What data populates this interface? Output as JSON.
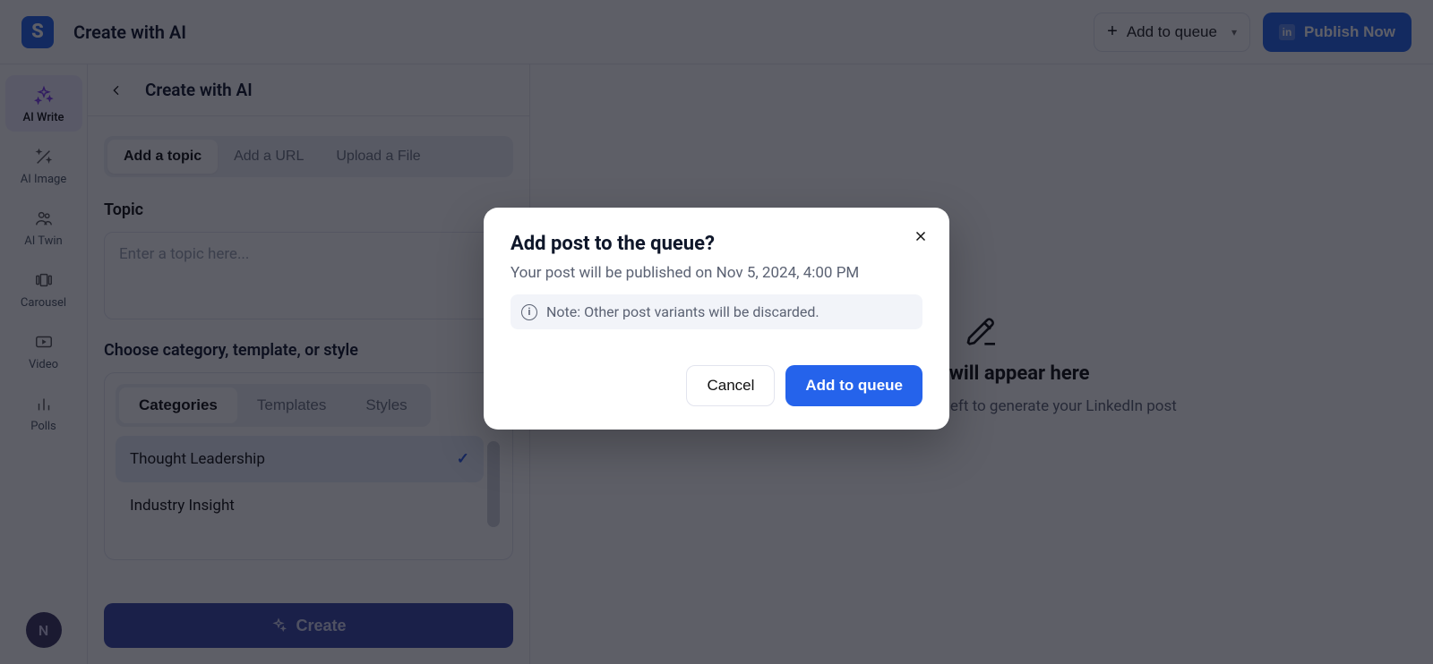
{
  "topbar": {
    "logo_letter": "S",
    "title": "Create with AI",
    "add_to_queue": "Add to queue",
    "publish_now": "Publish Now",
    "linkedin_badge": "in"
  },
  "sidebar": {
    "items": [
      {
        "label": "AI Write"
      },
      {
        "label": "AI Image"
      },
      {
        "label": "AI Twin"
      },
      {
        "label": "Carousel"
      },
      {
        "label": "Video"
      },
      {
        "label": "Polls"
      }
    ],
    "avatar_initial": "N"
  },
  "left": {
    "header": "Create with AI",
    "tabs": [
      {
        "label": "Add a topic"
      },
      {
        "label": "Add a URL"
      },
      {
        "label": "Upload a File"
      }
    ],
    "topic_label": "Topic",
    "topic_placeholder": "Enter a topic here...",
    "choose_label": "Choose category, template, or style",
    "cat_tabs": [
      {
        "label": "Categories"
      },
      {
        "label": "Templates"
      },
      {
        "label": "Styles"
      }
    ],
    "categories": [
      {
        "label": "Thought Leadership",
        "selected": true
      },
      {
        "label": "Industry Insight",
        "selected": false
      }
    ],
    "create_btn": "Create"
  },
  "right": {
    "title": "Preview will appear here",
    "subtitle": "Use the controls on the left to generate your LinkedIn post"
  },
  "modal": {
    "title": "Add post to the queue?",
    "subtitle": "Your post will be published on Nov 5, 2024, 4:00 PM",
    "note": "Note: Other post variants will be discarded.",
    "cancel": "Cancel",
    "confirm": "Add to queue"
  }
}
